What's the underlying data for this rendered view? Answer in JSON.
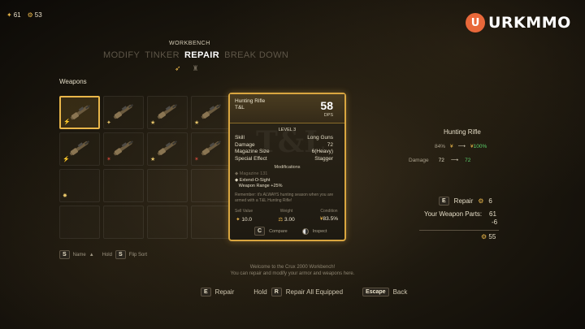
{
  "resources": {
    "bits": "61",
    "parts": "53"
  },
  "logo": {
    "mark": "U",
    "text": "URKMMO"
  },
  "workbench": {
    "title": "WORKBENCH",
    "tabs": [
      {
        "label": "MODIFY",
        "active": false
      },
      {
        "label": "TINKER",
        "active": false
      },
      {
        "label": "REPAIR",
        "active": true
      },
      {
        "label": "BREAK DOWN",
        "active": false
      }
    ]
  },
  "inventory": {
    "label": "Weapons",
    "slots": [
      {
        "filled": true,
        "selected": true,
        "tag": "⚡",
        "tag_color": "gold"
      },
      {
        "filled": true,
        "selected": false,
        "tag": "✦",
        "tag_color": "gold"
      },
      {
        "filled": true,
        "selected": false,
        "tag": "★",
        "tag_color": "gold"
      },
      {
        "filled": true,
        "selected": false,
        "tag": "★",
        "tag_color": "gold"
      },
      {
        "filled": true,
        "selected": false,
        "tag": "⚡",
        "tag_color": "gold"
      },
      {
        "filled": true,
        "selected": false,
        "tag": "✶",
        "tag_color": "red"
      },
      {
        "filled": true,
        "selected": false,
        "tag": "★",
        "tag_color": "gold"
      },
      {
        "filled": true,
        "selected": false,
        "tag": "✶",
        "tag_color": "red"
      },
      {
        "filled": false,
        "selected": false,
        "tag": "✸",
        "tag_color": "gold"
      },
      {
        "filled": false
      },
      {
        "filled": false
      },
      {
        "filled": false
      },
      {
        "filled": false
      },
      {
        "filled": false
      },
      {
        "filled": false
      },
      {
        "filled": false
      }
    ]
  },
  "sort_hint": {
    "key1": "S",
    "label1": "Name",
    "hold": "Hold",
    "key2": "S",
    "label2": "Flip Sort"
  },
  "item_card": {
    "name": "Hunting Rifle",
    "manufacturer": "T&L",
    "dps": "58",
    "dps_label": "DPS",
    "level": "LEVEL 3",
    "stats": [
      {
        "label": "Skill",
        "value": "Long Guns"
      },
      {
        "label": "Damage",
        "value": "72"
      },
      {
        "label": "Magazine Size",
        "value": "6(Heavy)"
      },
      {
        "label": "Special Effect",
        "value": "Stagger"
      }
    ],
    "mods_title": "Modifications",
    "mods": [
      {
        "text": "Magazine 131",
        "lit": false
      },
      {
        "text": "Extend-O-Sight",
        "lit": true
      },
      {
        "text": "Weapon Range +25%",
        "lit": true
      }
    ],
    "flavor": "Remember: it's ALWAYS hunting season when you are armed with a T&L Hunting Rifle!",
    "value_label": "Sell Value",
    "value": "10.0",
    "weight_label": "Weight",
    "weight": "3.00",
    "condition_label": "Condition",
    "condition": "83.5%",
    "compare_key": "C",
    "compare_label": "Compare",
    "inspect_label": "Inspect"
  },
  "repair_panel": {
    "title": "Hunting Rifle",
    "condition_from": "84%",
    "condition_to": "100%",
    "damage_label": "Damage",
    "damage_from": "72",
    "damage_to": "72",
    "repair_key": "E",
    "repair_label": "Repair",
    "repair_cost": "6",
    "parts_label": "Your Weapon Parts:",
    "parts_have": "61",
    "parts_cost": "-6",
    "parts_after": "55"
  },
  "welcome": {
    "line1": "Welcome to the Crux 2000 Workbench!",
    "line2": "You can repair and modify your armor and weapons here."
  },
  "bottom_bar": {
    "repair_key": "E",
    "repair_label": "Repair",
    "hold_label": "Hold",
    "repair_all_key": "R",
    "repair_all_label": "Repair All Equipped",
    "escape_key": "Escape",
    "escape_label": "Back"
  },
  "colors": {
    "accent": "#e9b64a",
    "positive": "#5ad06a",
    "warning": "#c9473a"
  }
}
